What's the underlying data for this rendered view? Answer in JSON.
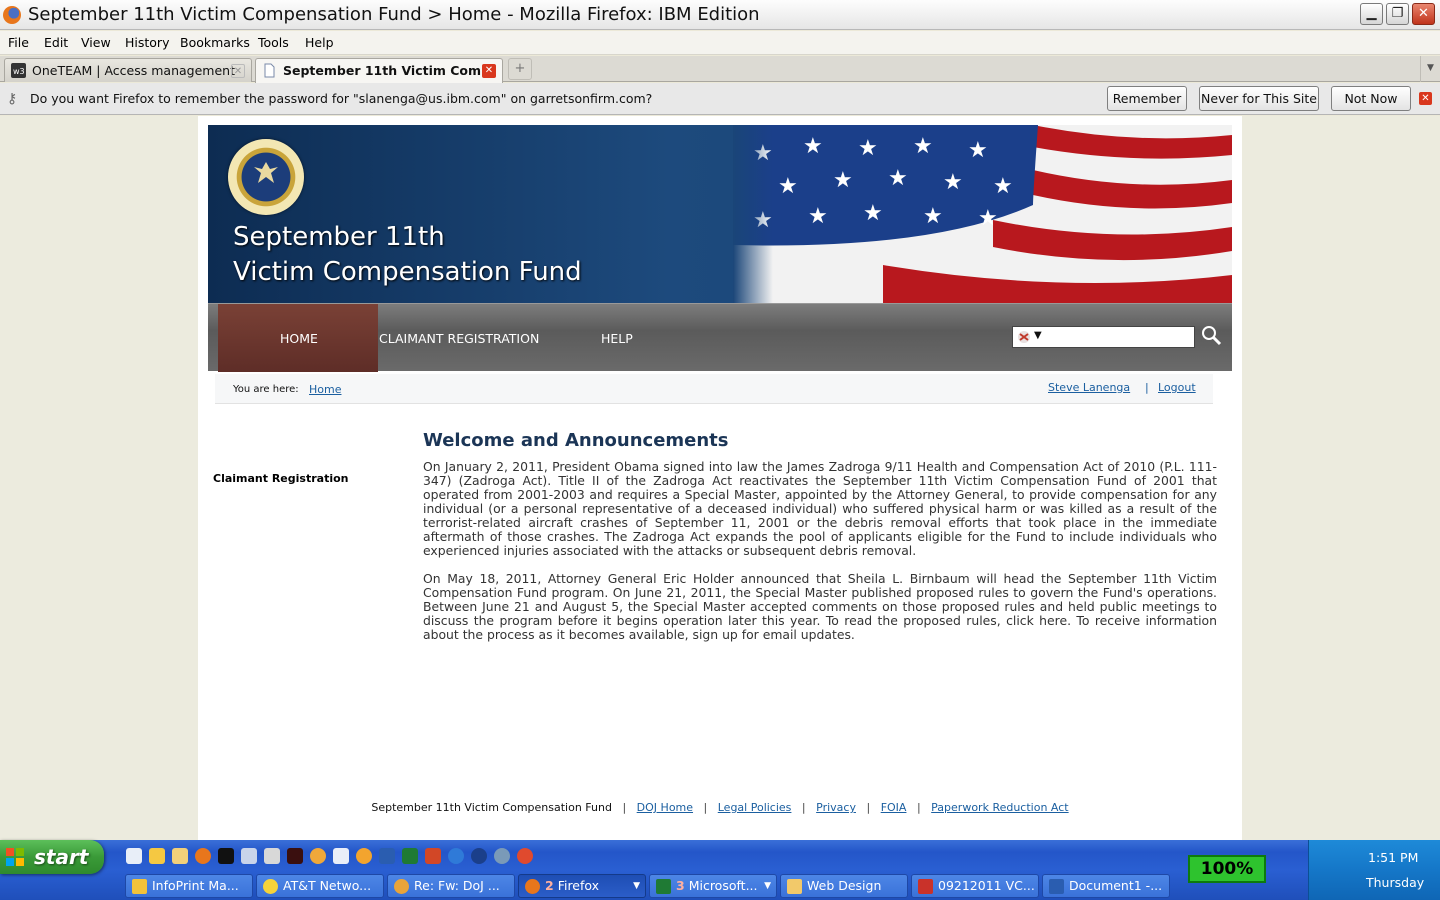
{
  "window": {
    "title": "September 11th Victim Compensation Fund > Home - Mozilla Firefox: IBM Edition"
  },
  "menubar": {
    "items": [
      "File",
      "Edit",
      "View",
      "History",
      "Bookmarks",
      "Tools",
      "Help"
    ]
  },
  "tabs": [
    {
      "label": "OneTEAM | Access management",
      "icon": "w3-icon",
      "active": false
    },
    {
      "label": "September 11th Victim Com...",
      "icon": "page-icon",
      "active": true
    }
  ],
  "notification": {
    "message": "Do you want Firefox to remember the password for \"slanenga@us.ibm.com\" on garretsonfirm.com?",
    "remember": "Remember",
    "never": "Never for This Site",
    "not_now": "Not Now"
  },
  "site": {
    "banner": {
      "line1": "September 11th",
      "line2": "Victim Compensation Fund"
    },
    "nav": {
      "home": "HOME",
      "claimant": "CLAIMANT REGISTRATION",
      "help": "HELP",
      "search_value": ""
    },
    "breadcrumb": {
      "prefix": "You are here:",
      "home": "Home",
      "user": "Steve Lanenga",
      "sep": "|",
      "logout": "Logout"
    },
    "sidebar": {
      "title": "Claimant Registration"
    },
    "content": {
      "title": "Welcome and Announcements",
      "paragraph1": "On January 2, 2011, President Obama signed into law the James Zadroga 9/11 Health and Compensation Act of 2010 (P.L. 111-347) (Zadroga Act). Title II of the Zadroga Act reactivates the September 11th Victim Compensation Fund of 2001 that operated from 2001-2003 and requires a Special Master, appointed by the Attorney General, to provide compensation for any individual (or a personal representative of a deceased individual) who suffered physical harm or was killed as a result of the terrorist-related aircraft crashes of September 11, 2001 or the debris removal efforts that took place in the immediate aftermath of those crashes. The Zadroga Act expands the pool of applicants eligible for the Fund to include individuals who experienced injuries associated with the attacks or subsequent debris removal.",
      "paragraph2": "On May 18, 2011, Attorney General Eric Holder announced that Sheila L. Birnbaum will head the September 11th Victim Compensation Fund program. On June 21, 2011, the Special Master published proposed rules to govern the Fund's operations. Between June 21 and August 5, the Special Master accepted comments on those proposed rules and held public meetings to discuss the program before it begins operation later this year. To read the proposed rules, click here. To receive information about the process as it becomes available, sign up for email updates."
    },
    "footer": {
      "site_name": "September 11th Victim Compensation Fund",
      "sep": "|",
      "links": [
        "DOJ Home",
        "Legal Policies",
        "Privacy",
        "FOIA",
        "Paperwork Reduction Act"
      ]
    }
  },
  "taskbar": {
    "start": "start",
    "buttons": [
      {
        "label": "InfoPrint Ma...",
        "count": "",
        "color": "#f2c23a"
      },
      {
        "label": "AT&T Netwo...",
        "count": "",
        "color": "#f5d33a"
      },
      {
        "label": "Re: Fw: DoJ ...",
        "count": "",
        "color": "#e9a43a"
      },
      {
        "label": "Firefox",
        "count": "2",
        "color": "#e8761c"
      },
      {
        "label": "Microsoft...",
        "count": "3",
        "color": "#1f7a34"
      },
      {
        "label": "Web Design",
        "count": "",
        "color": "#f2c96a"
      },
      {
        "label": "09212011 VC...",
        "count": "",
        "color": "#c9322a"
      },
      {
        "label": "Document1 -...",
        "count": "",
        "color": "#2a5db0"
      }
    ],
    "battery": "100%",
    "time": "1:51 PM",
    "day": "Thursday"
  }
}
